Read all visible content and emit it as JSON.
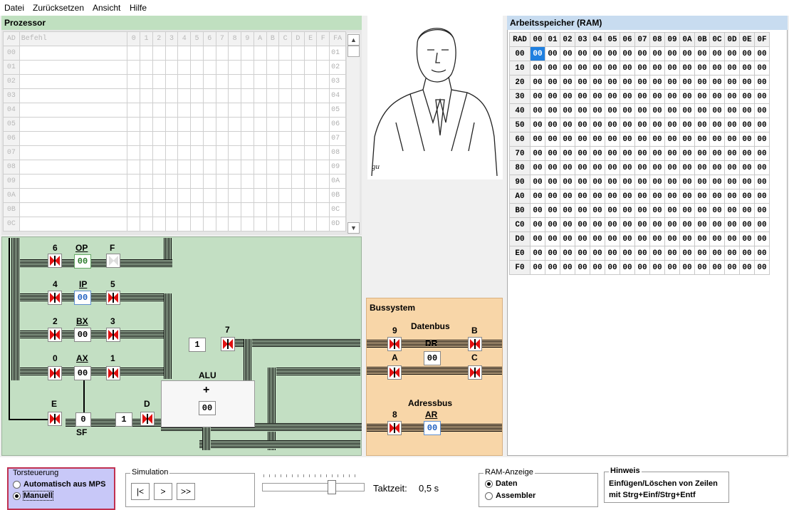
{
  "menu": {
    "datei": "Datei",
    "zuruecksetzen": "Zurücksetzen",
    "ansicht": "Ansicht",
    "hilfe": "Hilfe"
  },
  "processor": {
    "title": "Prozessor",
    "col_ad": "AD",
    "col_befehl": "Befehl",
    "cols": [
      "0",
      "1",
      "2",
      "3",
      "4",
      "5",
      "6",
      "7",
      "8",
      "9",
      "A",
      "B",
      "C",
      "D",
      "E",
      "F"
    ],
    "col_fa": "FA",
    "rows": [
      {
        "ad": "00",
        "fa": "01"
      },
      {
        "ad": "01",
        "fa": "02"
      },
      {
        "ad": "02",
        "fa": "03"
      },
      {
        "ad": "03",
        "fa": "04"
      },
      {
        "ad": "04",
        "fa": "05"
      },
      {
        "ad": "05",
        "fa": "06"
      },
      {
        "ad": "06",
        "fa": "07"
      },
      {
        "ad": "07",
        "fa": "08"
      },
      {
        "ad": "08",
        "fa": "09"
      },
      {
        "ad": "09",
        "fa": "0A"
      },
      {
        "ad": "0A",
        "fa": "0B"
      },
      {
        "ad": "0B",
        "fa": "0C"
      },
      {
        "ad": "0C",
        "fa": "0D"
      }
    ]
  },
  "circuit": {
    "op": {
      "label": "OP",
      "value": "00",
      "gate_num": "6"
    },
    "f": {
      "label": "F"
    },
    "ip": {
      "label": "IP",
      "value": "00",
      "gate_in": "4",
      "gate_out": "5"
    },
    "bx": {
      "label": "BX",
      "value": "00",
      "gate_in": "2",
      "gate_out": "3"
    },
    "ax": {
      "label": "AX",
      "value": "00",
      "gate_in": "0",
      "gate_out": "1"
    },
    "e": {
      "label": "E"
    },
    "sf": {
      "label": "SF",
      "value": "0"
    },
    "d": {
      "label": "D",
      "value": "1"
    },
    "gate7": {
      "label": "7",
      "value": "1"
    },
    "alu": {
      "label": "ALU",
      "op": "+",
      "value": "00"
    }
  },
  "bussystem": {
    "title": "Bussystem",
    "datenbus": "Datenbus",
    "adressbus": "Adressbus",
    "dr": {
      "label": "DR",
      "value": "00"
    },
    "ar": {
      "label": "AR",
      "value": "00"
    },
    "g9": "9",
    "gA": "A",
    "gB": "B",
    "gC": "C",
    "g8": "8"
  },
  "ram": {
    "title": "Arbeitsspeicher (RAM)",
    "corner": "RAD",
    "cols": [
      "00",
      "01",
      "02",
      "03",
      "04",
      "05",
      "06",
      "07",
      "08",
      "09",
      "0A",
      "0B",
      "0C",
      "0D",
      "0E",
      "0F"
    ],
    "rows": [
      "00",
      "10",
      "20",
      "30",
      "40",
      "50",
      "60",
      "70",
      "80",
      "90",
      "A0",
      "B0",
      "C0",
      "D0",
      "E0",
      "F0"
    ],
    "cell_value": "00",
    "selected": "00"
  },
  "bottom": {
    "torsteuerung": {
      "title": "Torsteuerung",
      "opt1": "Automatisch aus MPS",
      "opt2": "Manuell",
      "selected": "Manuell"
    },
    "simulation": {
      "title": "Simulation",
      "btn_reset": "|<",
      "btn_step": ">",
      "btn_run": ">>"
    },
    "takt": {
      "label": "Taktzeit:",
      "value": "0,5 s"
    },
    "ram_anzeige": {
      "title": "RAM-Anzeige",
      "opt1": "Daten",
      "opt2": "Assembler",
      "selected": "Daten"
    },
    "hinweis": {
      "title": "Hinweis",
      "line1": "Einfügen/Löschen von Zeilen",
      "line2": "mit Strg+Einf/Strg+Entf"
    }
  },
  "colors": {
    "processor_bg": "#c3dfc3",
    "bus_bg": "#f8d6a8",
    "gate_red": "#e01010",
    "ram_title": "#c8dcf0",
    "selected": "#2080e0"
  }
}
